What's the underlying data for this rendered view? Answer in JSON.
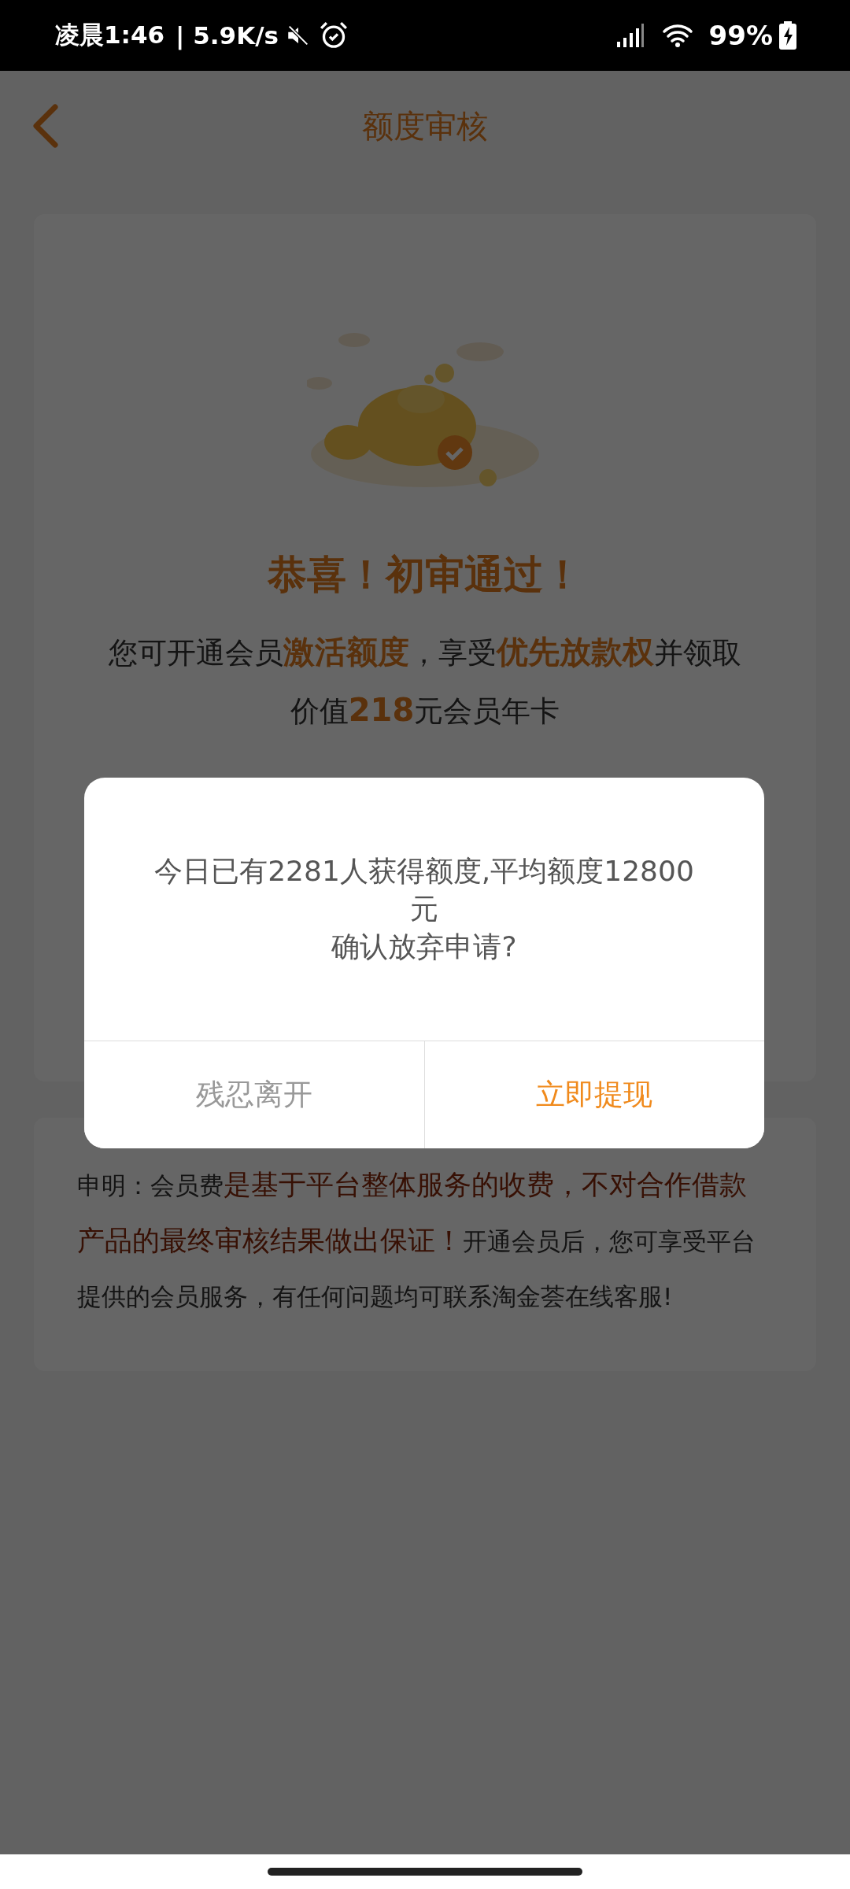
{
  "status_bar": {
    "time": "凌晨1:46",
    "speed": "| 5.9K/s",
    "battery": "99%"
  },
  "header": {
    "title": "额度审核"
  },
  "result_card": {
    "title": "恭喜！初审通过！",
    "message": [
      {
        "text": "您可开通会员",
        "emphasis": false
      },
      {
        "text": "激活额度",
        "emphasis": true
      },
      {
        "text": "，享受",
        "emphasis": false
      },
      {
        "text": "优先放款权",
        "emphasis": true
      },
      {
        "text": "并领取价值",
        "emphasis": false
      },
      {
        "text": "218",
        "emphasis": true
      },
      {
        "text": "元会员年卡",
        "emphasis": false
      }
    ]
  },
  "disclaimer": [
    {
      "text": "申明：会员费",
      "emphasis": false
    },
    {
      "text": "是基于平台整体服务的收费，不对合作借款产品的最终审核结果做出保证！",
      "emphasis": true
    },
    {
      "text": "开通会员后，您可享受平台提供的会员服务，有任何问题均可联系淘金荟在线客服!",
      "emphasis": false
    }
  ],
  "dialog": {
    "message_lines": [
      "今日已有2281人获得额度,平均额度12800元",
      "确认放弃申请?"
    ],
    "buttons": [
      {
        "label": "残忍离开",
        "kind": "secondary"
      },
      {
        "label": "立即提现",
        "kind": "primary"
      }
    ]
  }
}
